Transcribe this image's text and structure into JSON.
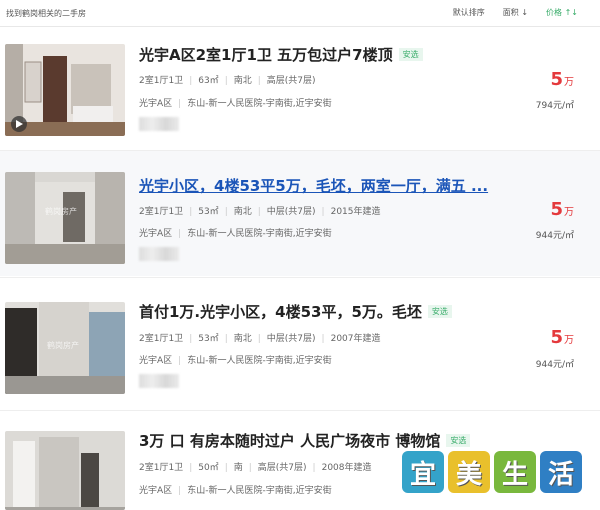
{
  "header": {
    "title": "找到鹤岗相关的二手房",
    "sort_default": "默认排序",
    "sort_area": "面积",
    "sort_area_arrow": "↓",
    "sort_price": "价格",
    "sort_price_arrow": "↑↓"
  },
  "listings": [
    {
      "title": "光宇A区2室1厅1卫 五万包过户7楼顶",
      "badge": "安选",
      "layout": "2室1厅1卫",
      "area": "63㎡",
      "orientation": "南北",
      "floor": "高层(共7层)",
      "year": "",
      "community": "光宇A区",
      "address": "东山-新一人民医院-宇南街,近宇安街",
      "price": "5",
      "price_unit": "万",
      "unit_price": "794元/㎡"
    },
    {
      "title": "光宇小区，4楼53平5万，毛坯，两室一厅，满五 ...",
      "badge": "",
      "layout": "2室1厅1卫",
      "area": "53㎡",
      "orientation": "南北",
      "floor": "中层(共7层)",
      "year": "2015年建造",
      "community": "光宇A区",
      "address": "东山-新一人民医院-宇南街,近宇安街",
      "price": "5",
      "price_unit": "万",
      "unit_price": "944元/㎡"
    },
    {
      "title": "首付1万.光宇小区，4楼53平，5万。毛坯",
      "badge": "安选",
      "layout": "2室1厅1卫",
      "area": "53㎡",
      "orientation": "南北",
      "floor": "中层(共7层)",
      "year": "2007年建造",
      "community": "光宇A区",
      "address": "东山-新一人民医院-宇南街,近宇安街",
      "price": "5",
      "price_unit": "万",
      "unit_price": "944元/㎡"
    },
    {
      "title": "3万 口 有房本随时过户 人民广场夜市 博物馆",
      "badge": "安选",
      "layout": "2室1厅1卫",
      "area": "50㎡",
      "orientation": "南",
      "floor": "高层(共7层)",
      "year": "2008年建造",
      "community": "光宇A区",
      "address": "东山-新一人民医院-宇南街,近宇安街",
      "price": "",
      "price_unit": "",
      "unit_price": ""
    }
  ],
  "photo_watermark": "鹤岗房产",
  "watermark": [
    "宜",
    "美",
    "生",
    "活"
  ],
  "colors": {
    "accent_green": "#39ac6a",
    "price_red": "#e4393c",
    "link_blue": "#1b55b8",
    "wm_1": "#34a3c9",
    "wm_2": "#e9c02c",
    "wm_3": "#79b83d",
    "wm_4": "#2f7fc4"
  }
}
